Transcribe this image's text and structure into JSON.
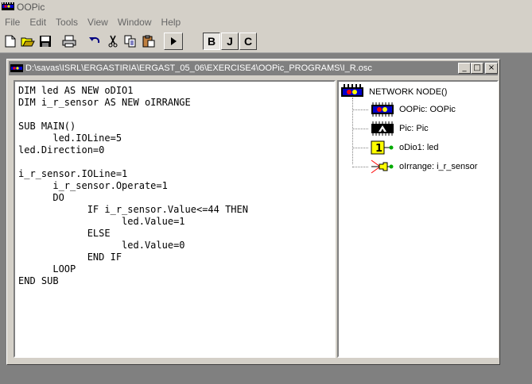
{
  "app": {
    "title": "OOPic"
  },
  "menu": {
    "items": [
      "File",
      "Edit",
      "Tools",
      "View",
      "Window",
      "Help"
    ]
  },
  "toolbar": {
    "icons": [
      "new-icon",
      "open-icon",
      "save-icon",
      "print-icon",
      "undo-icon",
      "cut-icon",
      "copy-icon",
      "paste-icon",
      "run-icon"
    ],
    "b_label": "B",
    "j_label": "J",
    "c_label": "C"
  },
  "window": {
    "title": "D:\\savas\\ISRL\\ERGASTIRIA\\ERGAST_05_06\\EXERCISE4\\OOPic_PROGRAMS\\I_R.osc",
    "minimize": "_",
    "maximize": "□",
    "close": "×"
  },
  "editor": {
    "code": "DIM led AS NEW oDIO1\nDIM i_r_sensor AS NEW oIRRANGE\n\nSUB MAIN()\n      led.IOLine=5\nled.Direction=0\n\ni_r_sensor.IOLine=1\n      i_r_sensor.Operate=1\n      DO\n            IF i_r_sensor.Value<=44 THEN\n                  led.Value=1\n            ELSE\n                  led.Value=0\n            END IF\n      LOOP\nEND SUB"
  },
  "tree": {
    "root": "NETWORK NODE()",
    "children": [
      "OOPic: OOPic",
      "Pic: Pic",
      "oDio1: led",
      "oIrrange: i_r_sensor"
    ]
  },
  "colors": {
    "face": "#d4d0c8",
    "workspace": "#808080",
    "title_inactive": "#808080",
    "led_yellow": "#ffff00",
    "net_blue": "#0000cc",
    "net_red": "#ff0000"
  }
}
